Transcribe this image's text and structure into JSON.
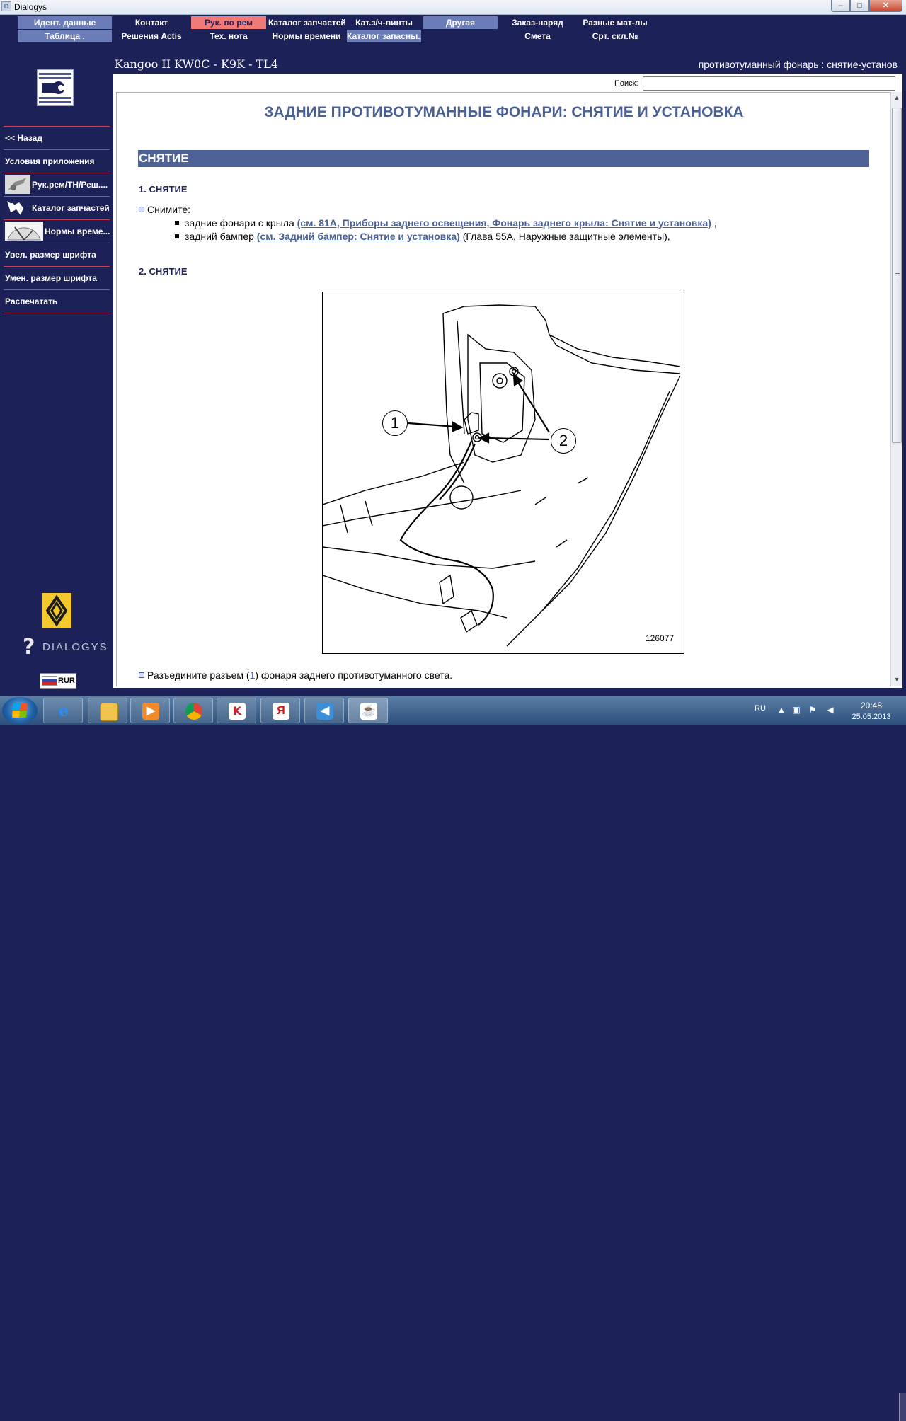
{
  "window": {
    "title": "Dialogys",
    "min": "–",
    "max": "□",
    "close": "✕"
  },
  "menu": {
    "row1": [
      "Идент. данные",
      "Контакт",
      "Рук. по рем",
      "Каталог запчастей",
      "Кат.з/ч-винты",
      "Другая",
      "Заказ-наряд",
      "Разные мат-лы"
    ],
    "row2": [
      "Таблица .",
      "Решения Actis",
      "Тех. нота",
      "Нормы времени",
      "Каталог запасны...",
      "Смета",
      "Срт. скл.№"
    ]
  },
  "sidebar": {
    "items": [
      {
        "label": "<< Назад"
      },
      {
        "label": "Условия приложения"
      },
      {
        "label": "Рук.рем/ТН/Реш...."
      },
      {
        "label": "Каталог запчастей"
      },
      {
        "label": "Нормы време..."
      },
      {
        "label": "Увел. размер шрифта"
      },
      {
        "label": "Умен. размер шрифта"
      },
      {
        "label": "Распечатать"
      }
    ],
    "brand": "DIALOGYS",
    "lang_code": "RUR"
  },
  "header": {
    "vehicle": "Kangoo II KW0C - K9K - TL4",
    "page_title": "противотуманный фонарь : снятие-установ"
  },
  "search": {
    "label": "Поиск:",
    "value": ""
  },
  "document": {
    "title": "ЗАДНИЕ ПРОТИВОТУМАННЫЕ ФОНАРИ: СНЯТИЕ И УСТАНОВКА",
    "section": "СНЯТИЕ",
    "step1": {
      "heading": "1. СНЯТИЕ",
      "intro": "Снимите:",
      "bullet1_text": "задние фонари с крыла ",
      "bullet1_link": "(см. 81A, Приборы заднего освещения, Фонарь заднего крыла: Снятие и установка)",
      "bullet1_tail": " ,",
      "bullet2_text": "задний бампер ",
      "bullet2_link": "(см. Задний бампер: Снятие и установка) ",
      "bullet2_tail": "(Глава 55A, Наружные защитные элементы),"
    },
    "step2": {
      "heading": "2. СНЯТИЕ",
      "figure_id": "126077",
      "callout_1": "1",
      "callout_2": "2",
      "instruction_pre": "Разъедините разъем (",
      "instruction_ref": "1",
      "instruction_post": ") фонаря заднего противотуманного света."
    }
  },
  "taskbar": {
    "lang": "RU",
    "time": "20:48",
    "date": "25.05.2013",
    "apps": [
      "ie-icon",
      "explorer-icon",
      "media-player-icon",
      "chrome-icon",
      "kaspersky-icon",
      "yandex-icon",
      "volume-app-icon",
      "java-icon"
    ]
  },
  "colors": {
    "navy": "#1c2157",
    "menu_light": "#6b7db9",
    "menu_active": "#f07a78",
    "heading_blue": "#4a5f94",
    "divider_red": "#c8445a"
  }
}
